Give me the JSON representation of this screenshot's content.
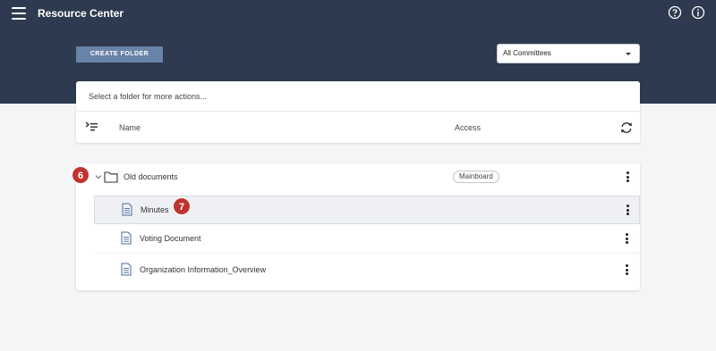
{
  "header": {
    "title": "Resource Center"
  },
  "toolbar": {
    "create_folder_label": "CREATE FOLDER"
  },
  "committee_select": {
    "selected": "All Committees"
  },
  "table": {
    "hint": "Select a folder for more actions...",
    "col_name": "Name",
    "col_access": "Access"
  },
  "folder": {
    "name": "Old documents",
    "access": "Mainboard"
  },
  "files": [
    {
      "name": "Minutes"
    },
    {
      "name": "Voting Document"
    },
    {
      "name": "Organization Information_Overview"
    }
  ],
  "annotations": {
    "step_six": "6",
    "step_seven": "7"
  },
  "colors": {
    "header_bg": "#2e3a4f",
    "button_bg": "#6a83a9",
    "step_badge": "#c0332f"
  }
}
